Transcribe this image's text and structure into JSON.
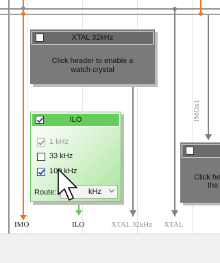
{
  "xtal_panel": {
    "title": "XTAL 32kHz",
    "enabled": false,
    "message": "Click header to enable a watch crystal"
  },
  "ilo_panel": {
    "title": "ILO",
    "enabled": true,
    "options": [
      {
        "label": "1 kHz",
        "checked": true,
        "disabled": true
      },
      {
        "label": "33 kHz",
        "checked": false,
        "disabled": false
      },
      {
        "label": "100 kHz",
        "checked": true,
        "disabled": false
      }
    ],
    "route_label": "Route:",
    "route_value": "kHz"
  },
  "partial_panel": {
    "message_line1": "Click he",
    "message_line2": "the"
  },
  "signals": {
    "imo": "IMO",
    "ilo": "ILO",
    "xtal32": "XTAL 32kHz",
    "xtal": "XTAL",
    "imox1": "IMOx1"
  },
  "colors": {
    "imo_wire": "#f07820",
    "gray_wire": "#808080",
    "ilo_wire": "#66c85a",
    "ilo_header": "#66cc5c",
    "disabled_panel": "#7a7a7a"
  }
}
